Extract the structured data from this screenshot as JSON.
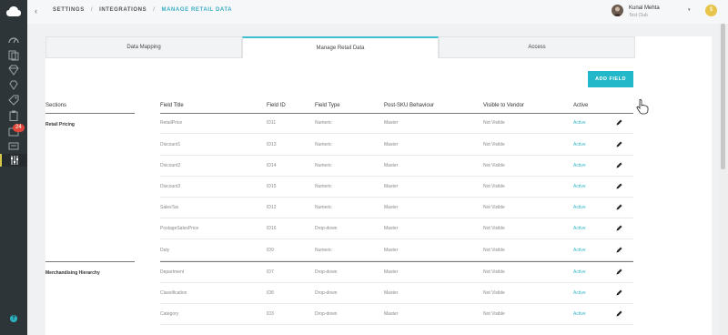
{
  "header": {
    "back_icon": "chevron-left-icon",
    "breadcrumbs": [
      "SETTINGS",
      "INTEGRATIONS",
      "MANAGE RETAIL DATA"
    ],
    "separator": "/",
    "user_name": "Kunal Mehta",
    "user_subtitle": "Test Club",
    "user_chevron": "▾",
    "coin_label": "$"
  },
  "sidebar": {
    "badge": "24",
    "help": "?"
  },
  "tabs": [
    "Data Mapping",
    "Manage Retail Data",
    "Access"
  ],
  "active_tab": 1,
  "add_field_label": "ADD FIELD",
  "columns": {
    "sections": "Sections",
    "field_title": "Field Title",
    "field_id": "Field ID",
    "field_type": "Field Type",
    "post_sku": "Post-SKU Behaviour",
    "visible": "Visible to Vendor",
    "active": "Active"
  },
  "sections": [
    {
      "label": "Retail Pricing"
    },
    {
      "label": "Merchandising Hierarchy"
    }
  ],
  "rows": [
    {
      "title": "RetailPrice",
      "id": "ID11",
      "type": "Numeric",
      "post": "Master",
      "visible": "Not Visible",
      "active": "Active"
    },
    {
      "title": "Discount1",
      "id": "ID13",
      "type": "Numeric",
      "post": "Master",
      "visible": "Not Visible",
      "active": "Active"
    },
    {
      "title": "Discount2",
      "id": "ID14",
      "type": "Numeric",
      "post": "Master",
      "visible": "Not Visible",
      "active": "Active"
    },
    {
      "title": "Discount3",
      "id": "ID15",
      "type": "Numeric",
      "post": "Master",
      "visible": "Not Visible",
      "active": "Active"
    },
    {
      "title": "SalesTax",
      "id": "ID12",
      "type": "Numeric",
      "post": "Master",
      "visible": "Not Visible",
      "active": "Active"
    },
    {
      "title": "PostageSalesPrice",
      "id": "ID16",
      "type": "Drop-down",
      "post": "Master",
      "visible": "Not Visible",
      "active": "Active"
    },
    {
      "title": "Duty",
      "id": "ID9",
      "type": "Numeric",
      "post": "Master",
      "visible": "Not Visible",
      "active": "Active"
    },
    {
      "title": "Department",
      "id": "ID7",
      "type": "Drop-down",
      "post": "Master",
      "visible": "Not Visible",
      "active": "Active"
    },
    {
      "title": "Classification",
      "id": "ID8",
      "type": "Drop-down",
      "post": "Master",
      "visible": "Not Visible",
      "active": "Active"
    },
    {
      "title": "Category",
      "id": "ID3",
      "type": "Drop-down",
      "post": "Master",
      "visible": "Not Visible",
      "active": "Active"
    }
  ],
  "colors": {
    "accent": "#22b7c9",
    "active_text": "#34b6c8",
    "sidebar": "#2e3539"
  }
}
